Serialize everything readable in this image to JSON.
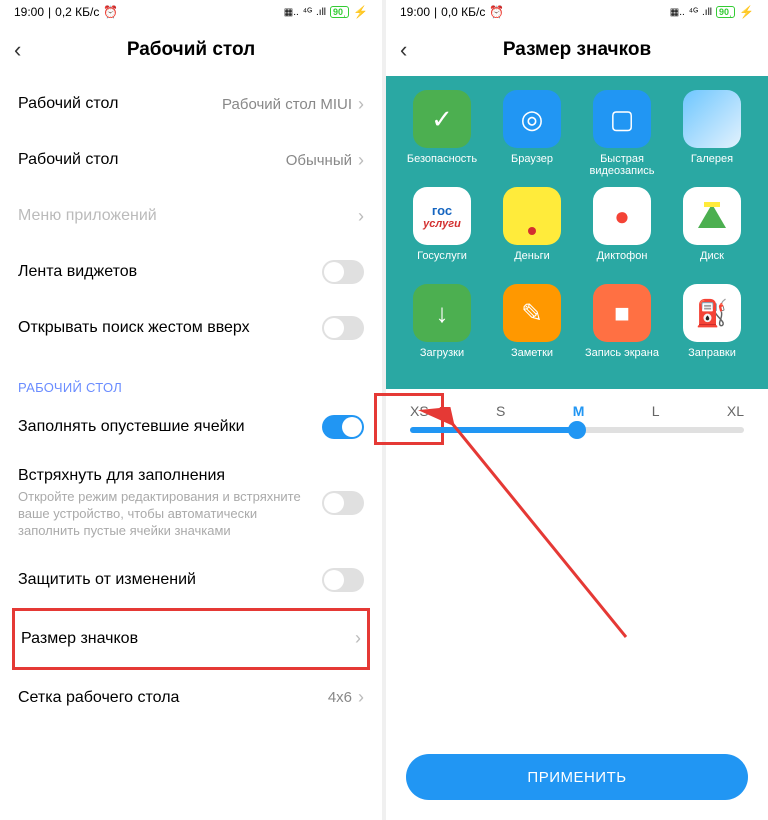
{
  "left": {
    "status": {
      "time": "19:00",
      "traffic": "0,2 КБ/с",
      "battery": "90"
    },
    "title": "Рабочий стол",
    "rows": {
      "launcher": {
        "label": "Рабочий стол",
        "value": "Рабочий стол MIUI"
      },
      "mode": {
        "label": "Рабочий стол",
        "value": "Обычный"
      },
      "appdrawer": {
        "label": "Меню приложений"
      },
      "widgets": {
        "label": "Лента виджетов"
      },
      "swipe": {
        "label": "Открывать поиск жестом вверх"
      }
    },
    "section": "РАБОЧИЙ СТОЛ",
    "rows2": {
      "fill": {
        "label": "Заполнять опустевшие ячейки"
      },
      "shake": {
        "label": "Встряхнуть для заполнения",
        "sub": "Откройте режим редактирования и встряхните ваше устройство, чтобы автоматически заполнить пустые ячейки значками"
      },
      "lock": {
        "label": "Защитить от изменений"
      },
      "size": {
        "label": "Размер значков"
      },
      "grid": {
        "label": "Сетка рабочего стола",
        "value": "4x6"
      }
    }
  },
  "right": {
    "status": {
      "time": "19:00",
      "traffic": "0,0 КБ/с",
      "battery": "90"
    },
    "title": "Размер значков",
    "apps": [
      {
        "name": "Безопасность",
        "cls": "ic-security",
        "glyph": "✓"
      },
      {
        "name": "Браузер",
        "cls": "ic-browser",
        "glyph": "◎"
      },
      {
        "name": "Быстрая видеозапись",
        "cls": "ic-rec",
        "glyph": "▢"
      },
      {
        "name": "Галерея",
        "cls": "ic-gallery",
        "glyph": ""
      },
      {
        "name": "Госуслуги",
        "cls": "ic-gos",
        "glyph": "гос"
      },
      {
        "name": "Деньги",
        "cls": "ic-money",
        "glyph": ""
      },
      {
        "name": "Диктофон",
        "cls": "ic-dict",
        "glyph": "●"
      },
      {
        "name": "Диск",
        "cls": "ic-disk",
        "glyph": ""
      },
      {
        "name": "Загрузки",
        "cls": "ic-dl",
        "glyph": "↓"
      },
      {
        "name": "Заметки",
        "cls": "ic-notes",
        "glyph": "✎"
      },
      {
        "name": "Запись экрана",
        "cls": "ic-screc",
        "glyph": "■"
      },
      {
        "name": "Заправки",
        "cls": "ic-fuel",
        "glyph": "⛽"
      }
    ],
    "sizes": [
      "XS",
      "S",
      "M",
      "L",
      "XL"
    ],
    "selected_size": "M",
    "apply": "ПРИМЕНИТЬ"
  }
}
